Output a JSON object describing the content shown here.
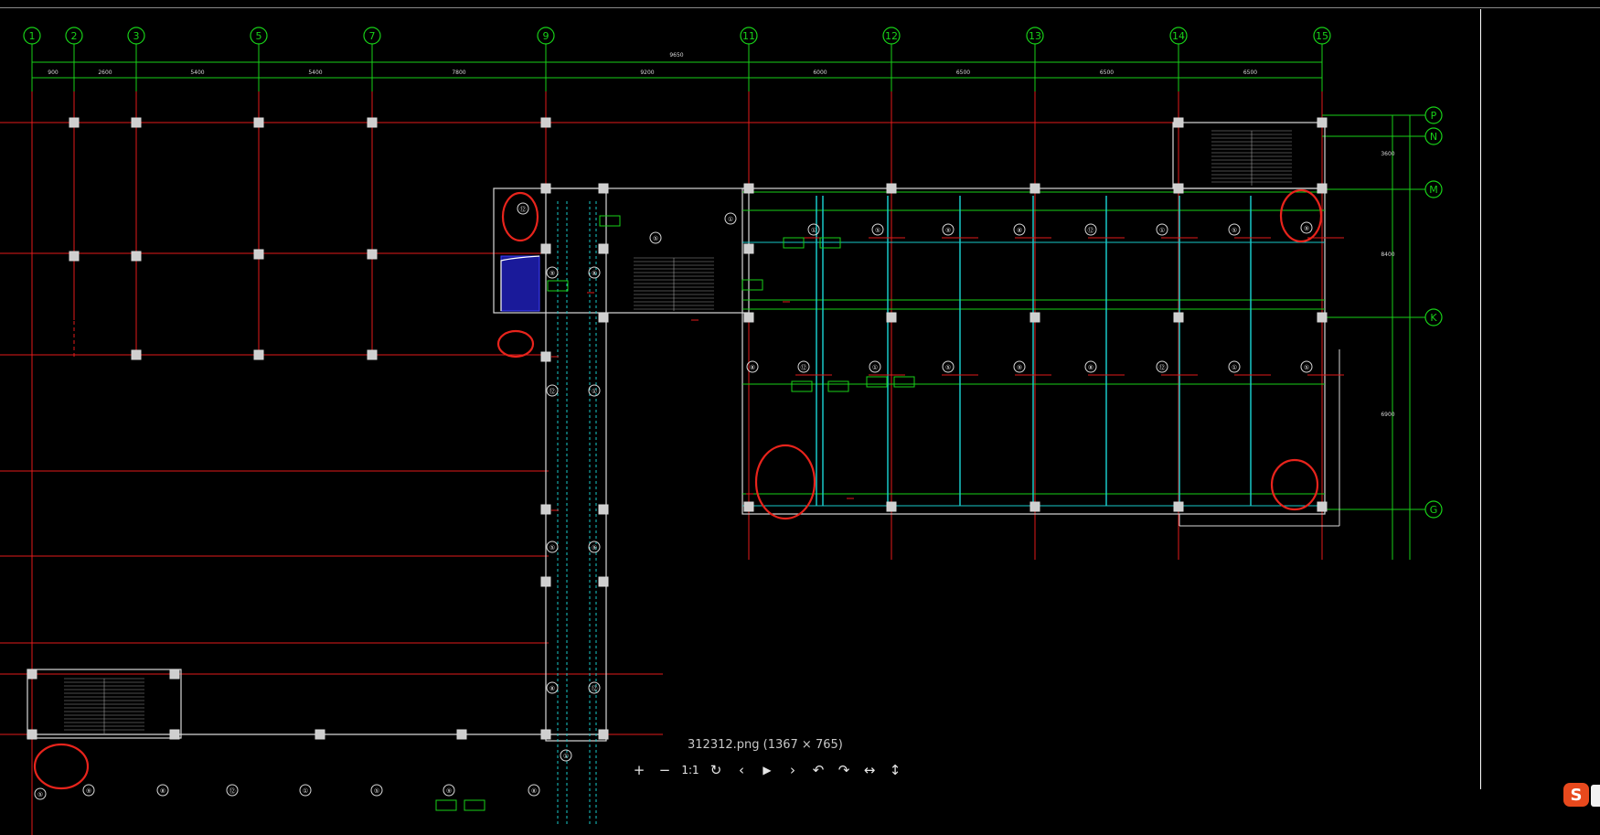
{
  "viewer": {
    "caption": "312312.png (1367 × 765)",
    "toolbar": [
      {
        "id": "zoom-in",
        "glyph": "+"
      },
      {
        "id": "zoom-out",
        "glyph": "−"
      },
      {
        "id": "actual-size",
        "glyph": "1:1"
      },
      {
        "id": "refresh",
        "glyph": "↻"
      },
      {
        "id": "previous",
        "glyph": "‹"
      },
      {
        "id": "play",
        "glyph": "▶"
      },
      {
        "id": "next",
        "glyph": "›"
      },
      {
        "id": "rotate-left",
        "glyph": "↶"
      },
      {
        "id": "rotate-right",
        "glyph": "↷"
      },
      {
        "id": "flip-horizontal",
        "glyph": "↔"
      },
      {
        "id": "flip-vertical",
        "glyph": "↕"
      }
    ],
    "ime_logo": "S"
  },
  "drawing": {
    "colors": {
      "axis": "#e21a1a",
      "dim": "#18d018",
      "beam": "#18c8c8",
      "wall": "#d8d8d8",
      "markup": "#e8241c",
      "background": "#000000"
    },
    "column_axes": [
      "1",
      "2",
      "3",
      "5",
      "7",
      "9",
      "11",
      "12",
      "13",
      "14",
      "15"
    ],
    "row_axes": [
      "P",
      "N",
      "M",
      "K",
      "G"
    ],
    "dim_texts": [
      "9650",
      "900",
      "2600",
      "5400",
      "5400",
      "7800",
      "9200",
      "6000",
      "6500",
      "6500",
      "6500",
      "3600",
      "8400",
      "6900"
    ],
    "tag_labels": [
      "①",
      "⑤",
      "⑨",
      "⑧",
      "⑫"
    ]
  }
}
